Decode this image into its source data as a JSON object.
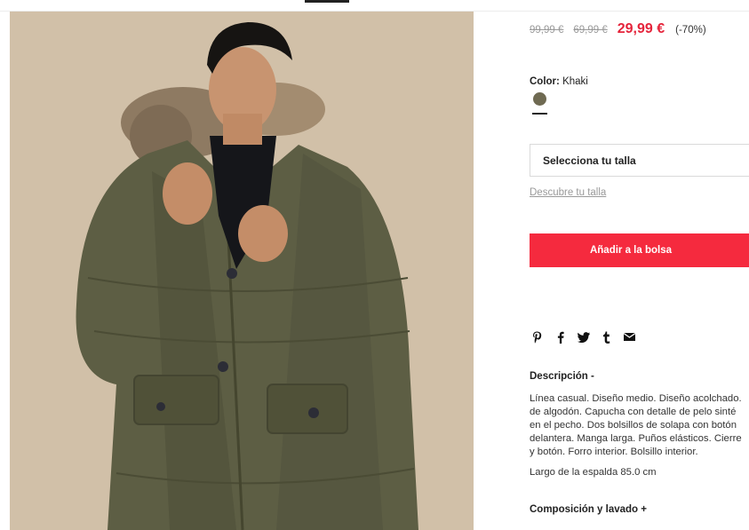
{
  "product": {
    "price_original": "99,99 €",
    "price_previous": "69,99 €",
    "price_sale": "29,99 €",
    "discount": "(-70%)",
    "color_label": "Color:",
    "color_value": "Khaki",
    "size_select_label": "Selecciona tu talla",
    "size_guide_link": "Descubre tu talla",
    "add_to_bag_label": "Añadir a la bolsa"
  },
  "share": {
    "icons": [
      "pinterest-icon",
      "facebook-icon",
      "twitter-icon",
      "tumblr-icon",
      "email-icon"
    ]
  },
  "description": {
    "title": "Descripción -",
    "lines": [
      "Línea casual. Diseño medio. Diseño acolchado.",
      "de algodón. Capucha con detalle de pelo sinté",
      "en el pecho. Dos bolsillos de solapa con botón",
      "delantera. Manga larga. Puños elásticos. Cierre",
      "y botón. Forro interior. Bolsillo interior."
    ],
    "length": "Largo de la espalda 85.0 cm"
  },
  "composition": {
    "title": "Composición y lavado +"
  },
  "colors": {
    "accent": "#f52a3e",
    "sale_price": "#e5243b",
    "swatch_khaki": "#6f6a52",
    "jacket": "#5d5e44",
    "photo_background": "#d5c4ac"
  }
}
